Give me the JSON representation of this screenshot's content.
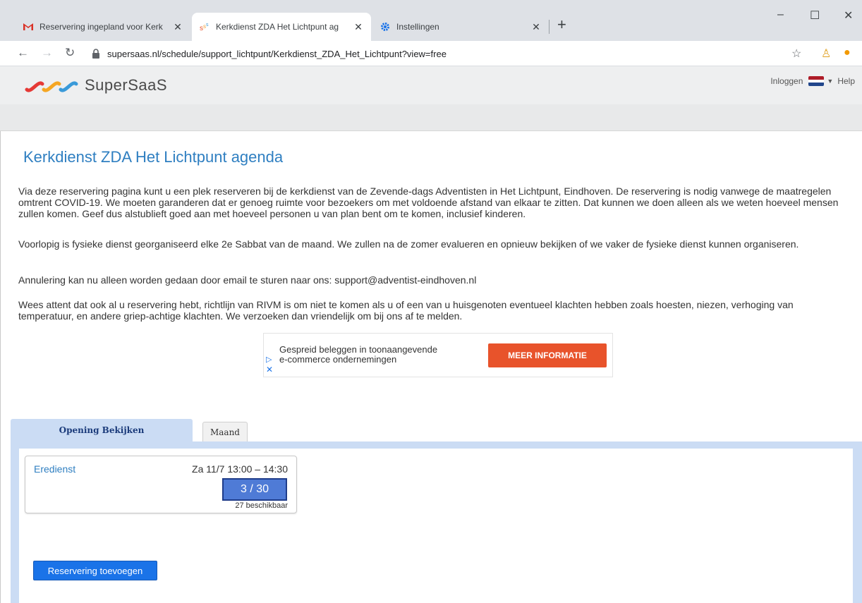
{
  "browser": {
    "tabs": [
      {
        "title": "Reservering ingepland voor Kerk",
        "icon": "gmail-icon"
      },
      {
        "title": "Kerkdienst ZDA Het Lichtpunt ag",
        "icon": "supersaas-icon"
      },
      {
        "title": "Instellingen",
        "icon": "gear-icon"
      }
    ],
    "url": "supersaas.nl/schedule/support_lichtpunt/Kerkdienst_ZDA_Het_Lichtpunt?view=free"
  },
  "header": {
    "logo_text": "SuperSaaS",
    "login_label": "Inloggen",
    "help_label": "Help"
  },
  "page": {
    "title": "Kerkdienst ZDA Het Lichtpunt agenda",
    "paragraphs": [
      "Via deze reservering pagina kunt u een plek reserveren bij de kerkdienst van de Zevende-dags Adventisten in Het Lichtpunt, Eindhoven.  De reservering is nodig vanwege de maatregelen omtrent COVID-19.  We moeten garanderen dat er genoeg ruimte voor bezoekers om met voldoende afstand van elkaar te zitten.  Dat kunnen we doen alleen als we weten hoeveel mensen zullen komen.  Geef dus alstublieft goed aan met hoeveel personen u van plan bent om te komen, inclusief kinderen.",
      "Voorlopig is fysieke dienst georganiseerd elke 2e Sabbat van de maand.  We zullen na de zomer evalueren en opnieuw bekijken of we vaker de fysieke dienst kunnen organiseren.",
      "Annulering kan nu alleen worden gedaan door email te sturen naar ons: support@adventist-eindhoven.nl",
      "Wees attent dat ook al u reservering hebt, richtlijn van RIVM is om niet te komen als u of een van u huisgenoten eventueel klachten hebben zoals hoesten, niezen, verhoging van temperatuur, en andere griep-achtige klachten.  We verzoeken dan vriendelijk om bij ons af te melden."
    ]
  },
  "ad": {
    "line1": "Gespreid beleggen in toonaangevende",
    "line2": "e-commerce ondernemingen",
    "button": "MEER INFORMATIE"
  },
  "schedule": {
    "tabs": [
      "Opening Bekijken",
      "Maand"
    ],
    "slot": {
      "name": "Eredienst",
      "time": "Za 11/7  13:00 – 14:30",
      "count": "3 / 30",
      "available": "27 beschikbaar"
    },
    "add_button": "Reservering toevoegen"
  },
  "colors": {
    "accent": "#2f7fc1",
    "tab_active": "#cbdcf4",
    "slot_count_bg": "#4f7bd6",
    "button_blue": "#1a73e8",
    "ad_button": "#e8532b"
  }
}
